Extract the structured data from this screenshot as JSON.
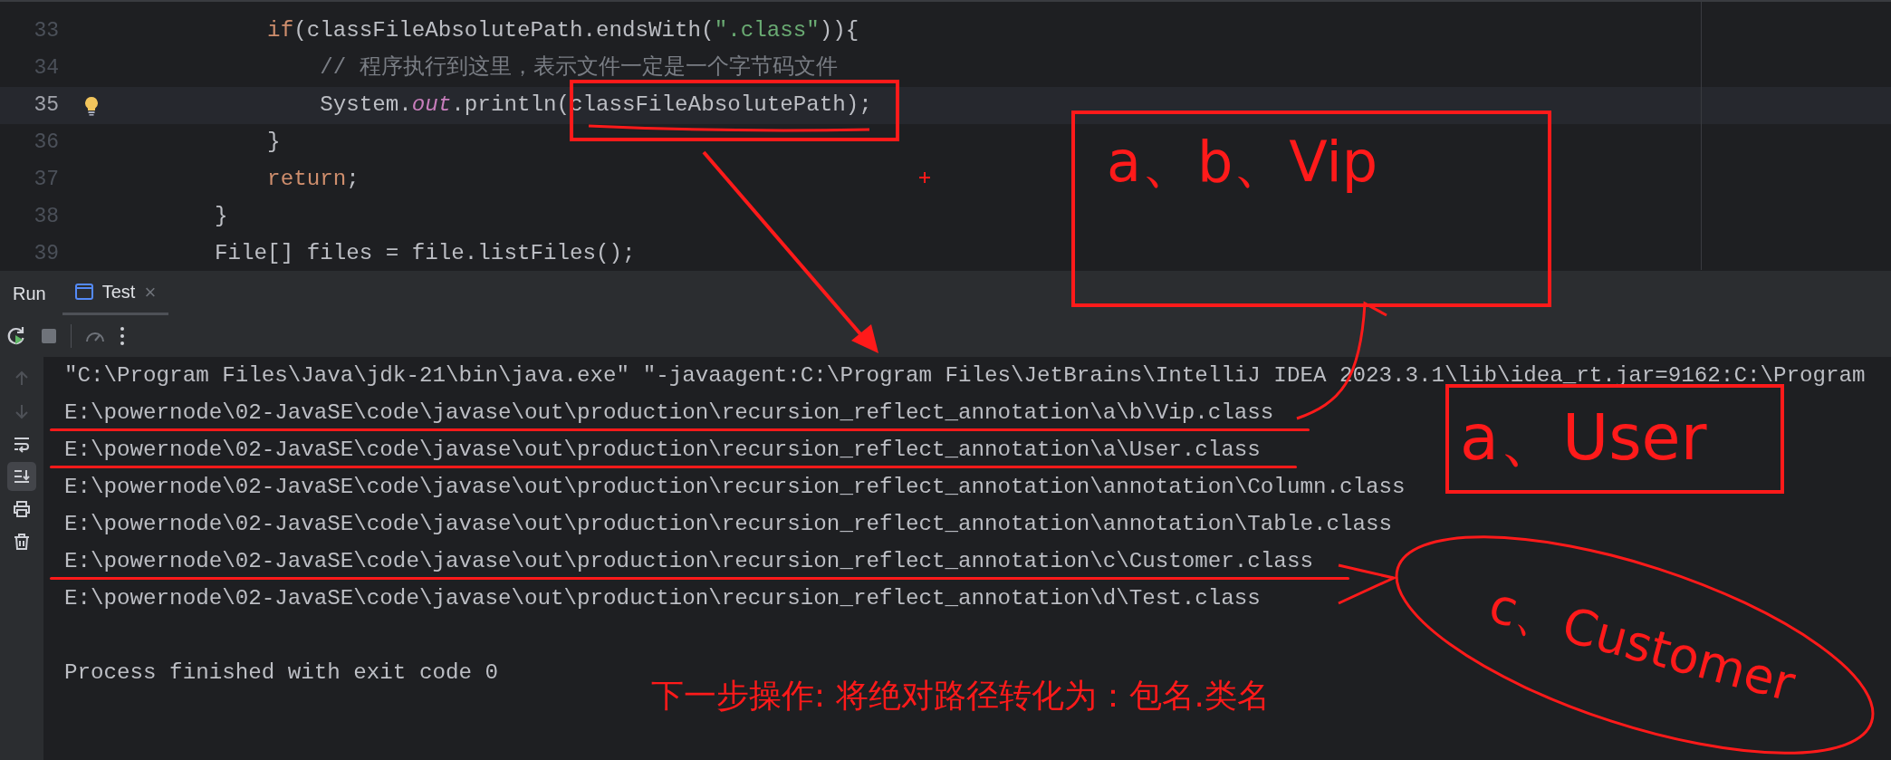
{
  "editor": {
    "lines": [
      {
        "number": "33",
        "current": false,
        "bulb": false,
        "tokens": [
          {
            "text": "        if",
            "kind": "keyword"
          },
          {
            "text": "(classFileAbsolutePath.endsWith(",
            "kind": "plain"
          },
          {
            "text": "\".class\"",
            "kind": "string"
          },
          {
            "text": ")){",
            "kind": "plain"
          }
        ]
      },
      {
        "number": "34",
        "current": false,
        "bulb": false,
        "tokens": [
          {
            "text": "            // 程序执行到这里，表示文件一定是一个字节码文件",
            "kind": "comment"
          }
        ]
      },
      {
        "number": "35",
        "current": true,
        "bulb": true,
        "tokens": [
          {
            "text": "            System.",
            "kind": "plain"
          },
          {
            "text": "out",
            "kind": "field"
          },
          {
            "text": ".println(classFileAbsolutePath);",
            "kind": "plain"
          }
        ]
      },
      {
        "number": "36",
        "current": false,
        "bulb": false,
        "tokens": [
          {
            "text": "        }",
            "kind": "plain"
          }
        ]
      },
      {
        "number": "37",
        "current": false,
        "bulb": false,
        "tokens": [
          {
            "text": "        return",
            "kind": "keyword"
          },
          {
            "text": ";",
            "kind": "plain"
          }
        ]
      },
      {
        "number": "38",
        "current": false,
        "bulb": false,
        "tokens": [
          {
            "text": "    }",
            "kind": "plain"
          }
        ]
      },
      {
        "number": "39",
        "current": false,
        "bulb": false,
        "tokens": [
          {
            "text": "    File[] files = file.listFiles();",
            "kind": "plain"
          }
        ]
      }
    ]
  },
  "run_panel": {
    "title": "Run",
    "tabs": [
      {
        "label": "Test",
        "selected": true,
        "close": "×"
      }
    ],
    "side_tools": [
      {
        "kind": "up",
        "disabled": true,
        "on": false
      },
      {
        "kind": "down",
        "disabled": true,
        "on": false
      },
      {
        "kind": "wrap",
        "disabled": false,
        "on": false
      },
      {
        "kind": "scroll_end",
        "disabled": false,
        "on": true
      },
      {
        "kind": "print",
        "disabled": false,
        "on": false
      },
      {
        "kind": "delete",
        "disabled": false,
        "on": false
      }
    ],
    "console": {
      "lines": [
        {
          "text": "\"C:\\Program Files\\Java\\jdk-21\\bin\\java.exe\" \"-javaagent:C:\\Program Files\\JetBrains\\IntelliJ IDEA 2023.3.1\\lib\\idea_rt.jar=9162:C:\\Program",
          "underlined": false
        },
        {
          "text": "E:\\powernode\\02-JavaSE\\code\\javase\\out\\production\\recursion_reflect_annotation\\a\\b\\Vip.class",
          "underlined": true
        },
        {
          "text": "E:\\powernode\\02-JavaSE\\code\\javase\\out\\production\\recursion_reflect_annotation\\a\\User.class",
          "underlined": true
        },
        {
          "text": "E:\\powernode\\02-JavaSE\\code\\javase\\out\\production\\recursion_reflect_annotation\\annotation\\Column.class",
          "underlined": false
        },
        {
          "text": "E:\\powernode\\02-JavaSE\\code\\javase\\out\\production\\recursion_reflect_annotation\\annotation\\Table.class",
          "underlined": false
        },
        {
          "text": "E:\\powernode\\02-JavaSE\\code\\javase\\out\\production\\recursion_reflect_annotation\\c\\Customer.class",
          "underlined": true
        },
        {
          "text": "E:\\powernode\\02-JavaSE\\code\\javase\\out\\production\\recursion_reflect_annotation\\d\\Test.class",
          "underlined": false
        }
      ],
      "exit_message": "Process finished with exit code 0"
    }
  },
  "annotations": {
    "handwritten": [
      {
        "text": "a、b、Vip"
      },
      {
        "text": "a、User"
      },
      {
        "text": "c、Customer"
      }
    ],
    "note": "下一步操作: 将绝对路径转化为：包名.类名"
  }
}
